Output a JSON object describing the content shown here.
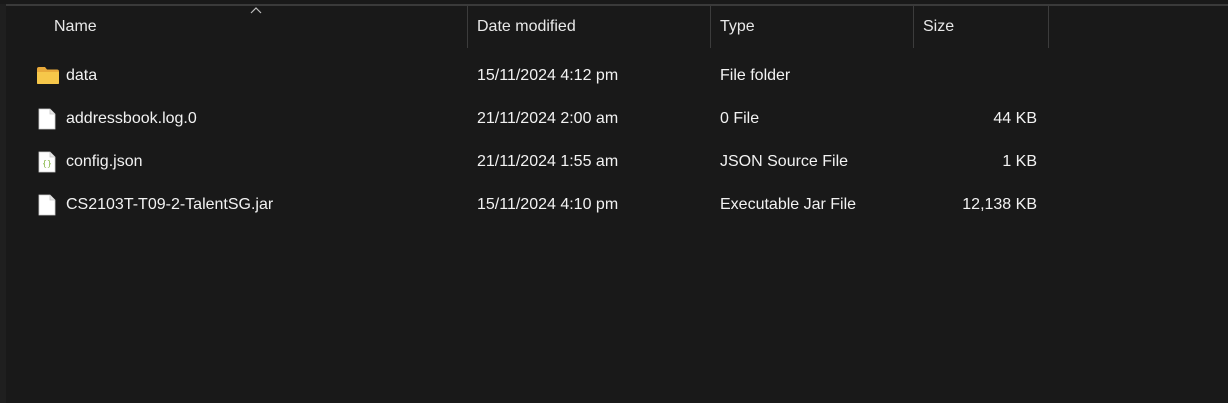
{
  "columns": {
    "name": "Name",
    "date_modified": "Date modified",
    "type": "Type",
    "size": "Size"
  },
  "files": [
    {
      "icon": "folder-icon",
      "name": "data",
      "date_modified": "15/11/2024 4:12 pm",
      "type": "File folder",
      "size": ""
    },
    {
      "icon": "file-icon",
      "name": "addressbook.log.0",
      "date_modified": "21/11/2024 2:00 am",
      "type": "0 File",
      "size": "44 KB"
    },
    {
      "icon": "json-file-icon",
      "name": "config.json",
      "date_modified": "21/11/2024 1:55 am",
      "type": "JSON Source File",
      "size": "1 KB"
    },
    {
      "icon": "file-icon",
      "name": "CS2103T-T09-2-TalentSG.jar",
      "date_modified": "15/11/2024 4:10 pm",
      "type": "Executable Jar File",
      "size": "12,138 KB"
    }
  ],
  "colors": {
    "background": "#191919",
    "text": "#f2f2f2",
    "folder": "#f5c542",
    "json_brace": "#8fbf3f"
  }
}
